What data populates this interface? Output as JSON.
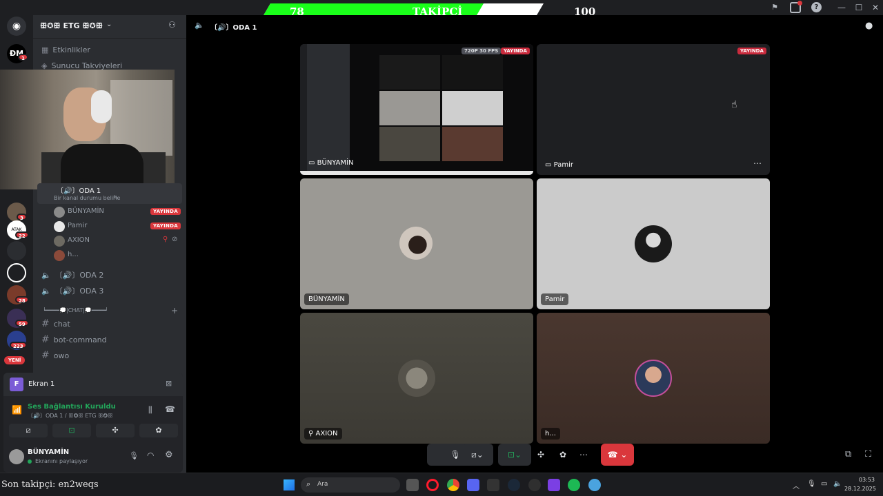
{
  "follower_bar": {
    "current": "78",
    "label": "TAKİPÇİ",
    "goal": "100",
    "progress": 0.78
  },
  "server": {
    "name": "ꕥ✪ꕥ ETG ꕥ✪ꕥ"
  },
  "sidebar": {
    "top_items": [
      {
        "label": "Etkinlikler",
        "icon": "calendar-icon"
      },
      {
        "label": "Sunucu Takviyeleri",
        "icon": "boost-icon"
      }
    ],
    "active_voice": {
      "name": "〔🔊〕ODA 1",
      "status_placeholder": "Bir kanal durumu belirle",
      "members": [
        {
          "name": "BÜNYAMİN",
          "badge": "YAYINDA"
        },
        {
          "name": "Pamir",
          "badge": "YAYINDA"
        },
        {
          "name": "AXION",
          "badge": ""
        },
        {
          "name": "h...",
          "badge": ""
        }
      ]
    },
    "voice_channels": [
      "〔🔊〕ODA 2",
      "〔🔊〕ODA 3"
    ],
    "category": "┕━━━━💭|CHAT|💭━━━━┙",
    "text_channels": [
      "chat",
      "bot-command",
      "owo"
    ]
  },
  "rail": {
    "badges": [
      "1",
      "3",
      "22",
      "28",
      "59",
      "223"
    ],
    "new_label": "YENİ"
  },
  "screen_share": {
    "title": "Ekran 1"
  },
  "voice_status": {
    "title": "Ses Bağlantısı Kuruldu",
    "subtitle": "〔🔊〕ODA 1 / ꕥ✪ꕥ ETG ꕥ✪ꕥ"
  },
  "user": {
    "name": "BÜNYAMİN",
    "status": "Ekranını paylaşıyor"
  },
  "main_header": {
    "channel": "〔🔊〕ODA 1"
  },
  "tiles": [
    {
      "name": "BÜNYAMİN",
      "badge": "YAYINDA",
      "quality": "720P 30 FPS"
    },
    {
      "name": "Pamir",
      "badge": "YAYINDA"
    },
    {
      "name": "BÜNYAMİN"
    },
    {
      "name": "Pamir"
    },
    {
      "name": "AXION"
    },
    {
      "name": "h..."
    }
  ],
  "overlay": {
    "last_follower": "Son takipçi: en2weqs"
  },
  "taskbar": {
    "search_placeholder": "Ara",
    "time": "03:53",
    "date": "28.12.2025"
  },
  "colors": {
    "accent_green": "#23a55a",
    "live_red": "#da373c",
    "follow_green": "#1aff1a",
    "blurple": "#5865f2"
  }
}
